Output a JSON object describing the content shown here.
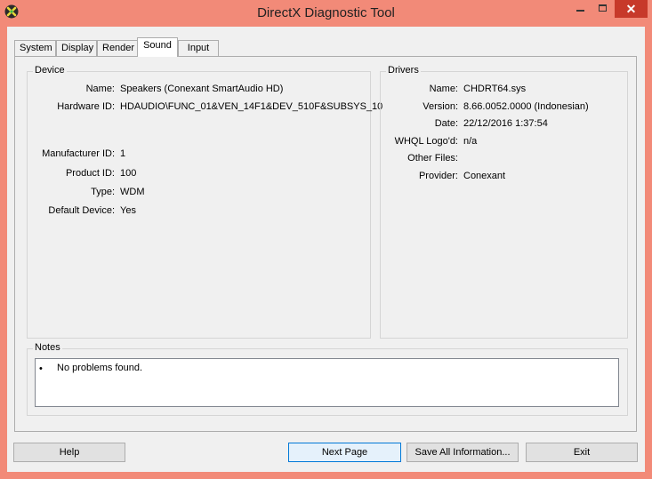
{
  "window": {
    "title": "DirectX Diagnostic Tool"
  },
  "tabs": [
    {
      "label": "System"
    },
    {
      "label": "Display"
    },
    {
      "label": "Render"
    },
    {
      "label": "Sound",
      "active": true
    },
    {
      "label": "Input"
    }
  ],
  "device": {
    "title": "Device",
    "fields": [
      {
        "label": "Name:",
        "value": "Speakers (Conexant SmartAudio HD)"
      },
      {
        "label": "Hardware ID:",
        "value": "HDAUDIO\\FUNC_01&VEN_14F1&DEV_510F&SUBSYS_10"
      },
      {
        "label": "Manufacturer ID:",
        "value": "1"
      },
      {
        "label": "Product ID:",
        "value": "100"
      },
      {
        "label": "Type:",
        "value": "WDM"
      },
      {
        "label": "Default Device:",
        "value": "Yes"
      }
    ]
  },
  "drivers": {
    "title": "Drivers",
    "fields": [
      {
        "label": "Name:",
        "value": "CHDRT64.sys"
      },
      {
        "label": "Version:",
        "value": "8.66.0052.0000 (Indonesian)"
      },
      {
        "label": "Date:",
        "value": "22/12/2016 1:37:54"
      },
      {
        "label": "WHQL Logo'd:",
        "value": "n/a"
      },
      {
        "label": "Other Files:",
        "value": ""
      },
      {
        "label": "Provider:",
        "value": "Conexant"
      }
    ]
  },
  "notes": {
    "title": "Notes",
    "items": [
      "No problems found."
    ]
  },
  "buttons": {
    "help": "Help",
    "next_page": "Next Page",
    "save_all": "Save All Information...",
    "exit": "Exit"
  },
  "colors": {
    "title_bar": "#f28a78",
    "close_button": "#c7392a",
    "focus_border": "#0078d7"
  }
}
